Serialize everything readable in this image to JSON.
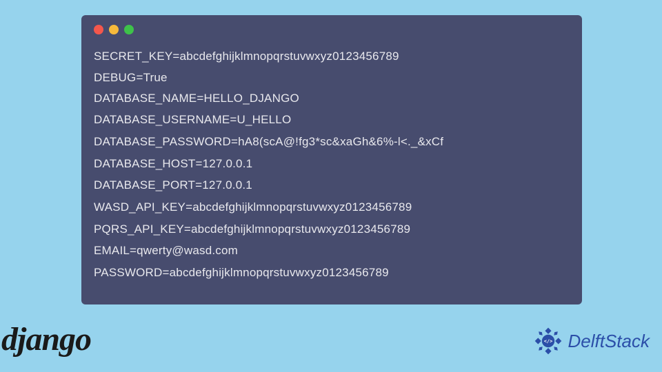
{
  "terminal": {
    "lines": [
      "SECRET_KEY=abcdefghijklmnopqrstuvwxyz0123456789",
      "DEBUG=True",
      "DATABASE_NAME=HELLO_DJANGO",
      "DATABASE_USERNAME=U_HELLO",
      "DATABASE_PASSWORD=hA8(scA@!fg3*sc&xaGh&6%-l<._&xCf",
      "DATABASE_HOST=127.0.0.1",
      "DATABASE_PORT=127.0.0.1",
      "WASD_API_KEY=abcdefghijklmnopqrstuvwxyz0123456789",
      "PQRS_API_KEY=abcdefghijklmnopqrstuvwxyz0123456789",
      "EMAIL=qwerty@wasd.com",
      "PASSWORD=abcdefghijklmnopqrstuvwxyz0123456789"
    ]
  },
  "logos": {
    "django": "django",
    "delftstack": "DelftStack"
  }
}
